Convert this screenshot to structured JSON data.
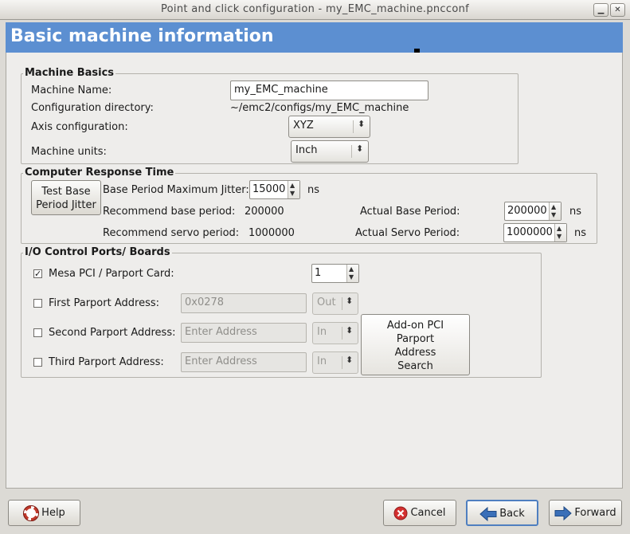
{
  "window": {
    "title": "Point and click configuration - my_EMC_machine.pncconf"
  },
  "banner": {
    "title": "Basic machine information"
  },
  "machine_basics": {
    "legend": "Machine Basics",
    "name_label": "Machine Name:",
    "name_value": "my_EMC_machine",
    "dir_label": "Configuration directory:",
    "dir_value": "~/emc2/configs/my_EMC_machine",
    "axis_label": "Axis configuration:",
    "axis_value": "XYZ",
    "units_label": "Machine units:",
    "units_value": "Inch"
  },
  "response_time": {
    "legend": "Computer Response Time",
    "test_button": "Test Base Period Jitter",
    "jitter_label": "Base Period Maximum Jitter:",
    "jitter_value": "15000",
    "jitter_unit": "ns",
    "rec_base_label": "Recommend base period:",
    "rec_base_value": "200000",
    "rec_servo_label": "Recommend servo period:",
    "rec_servo_value": "1000000",
    "act_base_label": "Actual Base Period:",
    "act_base_value": "200000",
    "act_base_unit": "ns",
    "act_servo_label": "Actual Servo Period:",
    "act_servo_value": "1000000",
    "act_servo_unit": "ns"
  },
  "io_ports": {
    "legend": "I/O Control Ports/ Boards",
    "mesa_label": "Mesa PCI / Parport Card:",
    "mesa_checked": true,
    "mesa_count": "1",
    "port1_label": "First Parport Address:",
    "port1_placeholder": "0x0278",
    "port1_dir": "Out",
    "port2_label": "Second Parport Address:",
    "port2_placeholder": "Enter Address",
    "port2_dir": "In",
    "port3_label": "Third Parport Address:",
    "port3_placeholder": "Enter Address",
    "port3_dir": "In",
    "search_button": "Add-on PCI Parport Address Search"
  },
  "footer": {
    "help": "Help",
    "cancel": "Cancel",
    "back": "Back",
    "forward": "Forward"
  },
  "colors": {
    "banner": "#5c8fd1",
    "background": "#dcdad5"
  }
}
